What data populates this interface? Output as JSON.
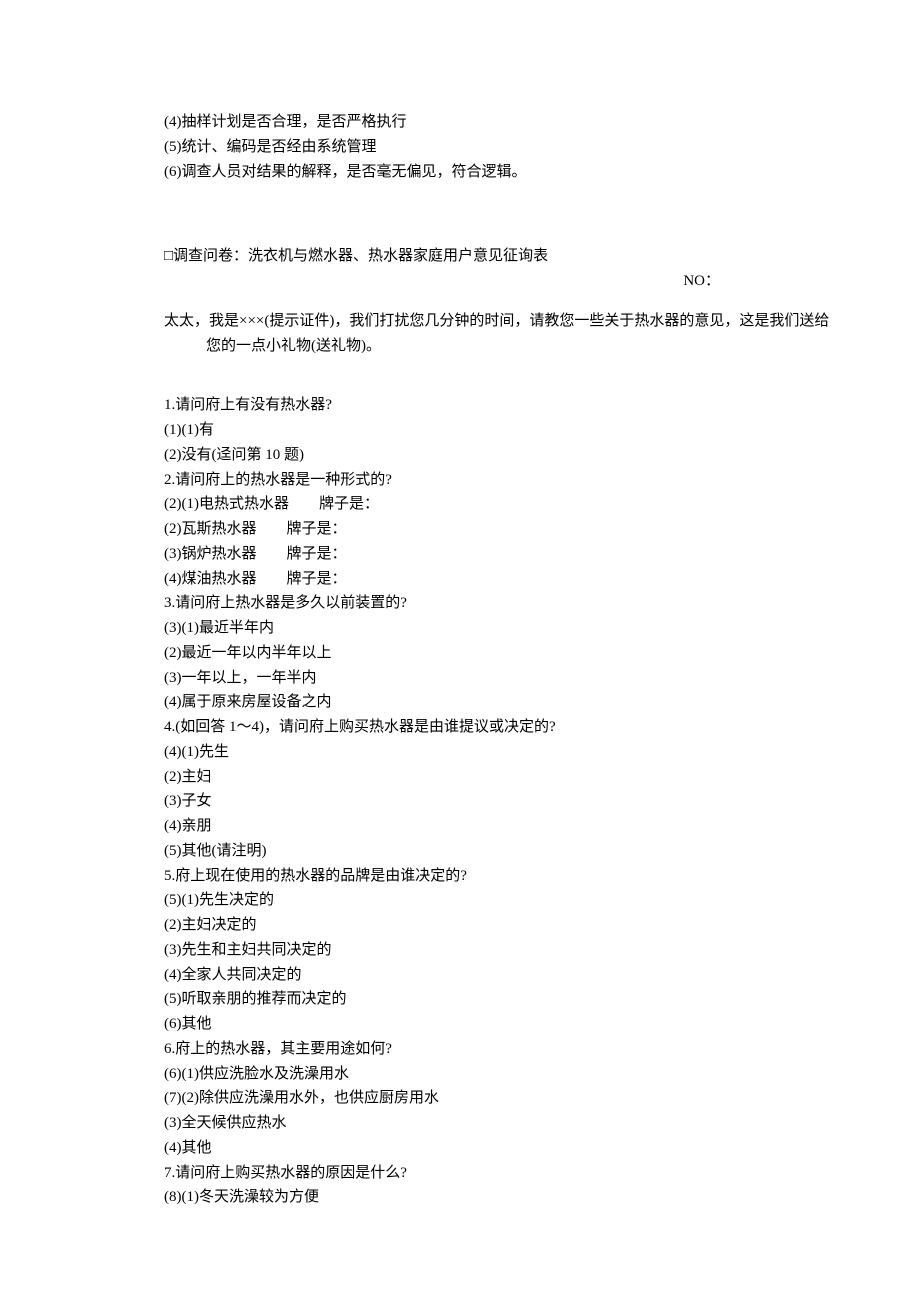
{
  "top": {
    "line1": "(4)抽样计划是否合理，是否严格执行",
    "line2": "(5)统计、编码是否经由系统管理",
    "line3": "(6)调查人员对结果的解释，是否毫无偏见，符合逻辑。"
  },
  "survey_title": "□调查问卷：洗衣机与燃水器、热水器家庭用户意见征询表",
  "no_label": "NO：",
  "intro": "太太，我是×××(提示证件)，我们打扰您几分钟的时间，请教您一些关于热水器的意见，这是我们送给您的一点小礼物(送礼物)。",
  "q1": {
    "title": "1.请问府上有没有热水器?",
    "a1": "(1)(1)有",
    "a2": "(2)没有(迳问第 10 题)"
  },
  "q2": {
    "title": "2.请问府上的热水器是一种形式的?",
    "a1": "(2)(1)电热式热水器",
    "a2": "(2)瓦斯热水器",
    "a3": "(3)锅炉热水器",
    "a4": "(4)煤油热水器",
    "brand": "牌子是："
  },
  "q3": {
    "title": "3.请问府上热水器是多久以前装置的?",
    "a1": "(3)(1)最近半年内",
    "a2": "(2)最近一年以内半年以上",
    "a3": "(3)一年以上，一年半内",
    "a4": "(4)属于原来房屋设备之内"
  },
  "q4": {
    "title": "4.(如回答 1～4)，请问府上购买热水器是由谁提议或决定的?",
    "a1": "(4)(1)先生",
    "a2": "(2)主妇",
    "a3": "(3)子女",
    "a4": "(4)亲朋",
    "a5": "(5)其他(请注明)"
  },
  "q5": {
    "title": "5.府上现在使用的热水器的品牌是由谁决定的?",
    "a1": "(5)(1)先生决定的",
    "a2": "(2)主妇决定的",
    "a3": "(3)先生和主妇共同决定的",
    "a4": "(4)全家人共同决定的",
    "a5": "(5)听取亲朋的推荐而决定的",
    "a6": "(6)其他"
  },
  "q6": {
    "title": "6.府上的热水器，其主要用途如何?",
    "a1": "(6)(1)供应洗脸水及洗澡用水",
    "a2": "(7)(2)除供应洗澡用水外，也供应厨房用水",
    "a3": "(3)全天候供应热水",
    "a4": "(4)其他"
  },
  "q7": {
    "title": "7.请问府上购买热水器的原因是什么?",
    "a1": "(8)(1)冬天洗澡较为方便"
  }
}
